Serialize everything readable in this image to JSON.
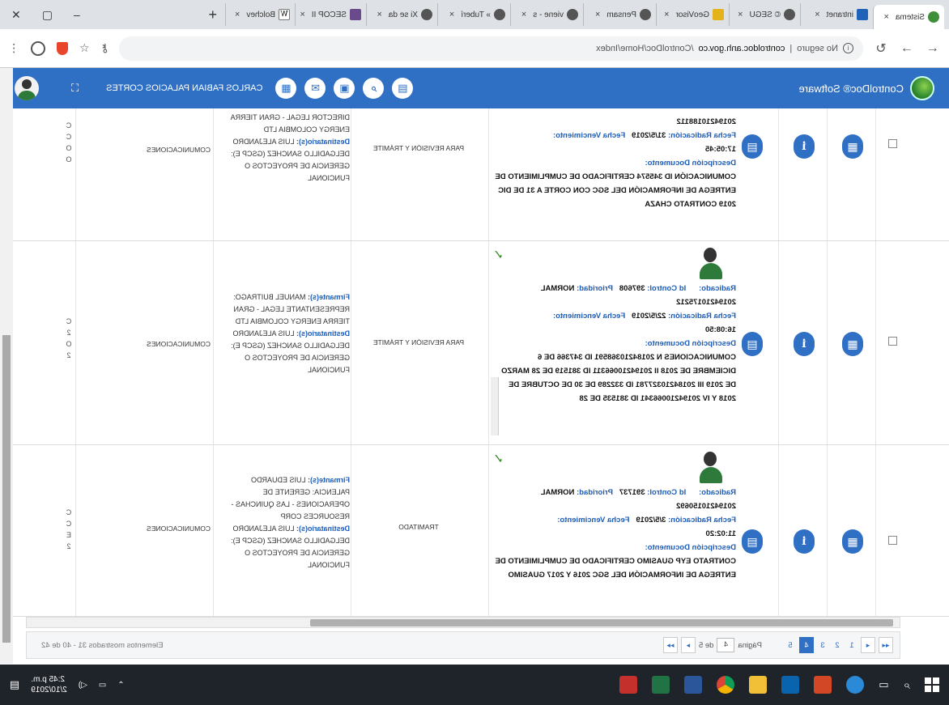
{
  "browser": {
    "tabs": [
      {
        "label": "Sistema",
        "icon": "app-logo-icon",
        "active": true
      },
      {
        "label": "intranet",
        "icon": "intranet-icon"
      },
      {
        "label": "© SEGU",
        "icon": "globe-icon"
      },
      {
        "label": "GeoVisor",
        "icon": "geovisor-icon"
      },
      {
        "label": "Pensam",
        "icon": "globe-icon"
      },
      {
        "label": "viene - s",
        "icon": "globe-icon"
      },
      {
        "label": "» Tuberí",
        "icon": "globe-icon"
      },
      {
        "label": "Xi se da",
        "icon": "globe-icon"
      },
      {
        "label": "SECOP II",
        "icon": "secop-icon"
      },
      {
        "label": "Bolchev",
        "icon": "wikipedia-icon"
      }
    ],
    "tab_close": "×",
    "new_tab": "+",
    "window_controls": {
      "minimize": "–",
      "maximize": "▢",
      "close": "✕"
    },
    "security": "No seguro",
    "url_host": "controldoc.anh.gov.co",
    "url_path": "/ControlDoc/Home/Index"
  },
  "app": {
    "brand": "ControlDoc® Software",
    "user_name": "CARLOS FABIAN PALACIOS CORTES",
    "header_icons": [
      "document-icon",
      "search-icon",
      "inbox-icon",
      "mail-icon",
      "report-icon"
    ],
    "fullscreen": "⛶"
  },
  "rows": [
    {
      "radicado_no": "20194210188112",
      "fecha_radicacion_label": "Fecha Radicación:",
      "fecha_radicacion": "31/5/2019",
      "fecha_venc_label": "Fecha Vencimiento:",
      "hora": "17:05:45",
      "desc_label": "Descripción Documento:",
      "descripcion": "COMUNICACIÓN ID 345574 CERTIFICADO DE CUMPLIMIENTO DE ENTREGA DE INFORMACIÓN DEL SGC CON CORTE A 31 DE DIC 2019 CONTRATO CHAZA",
      "estado": "PARA REVISIÓN Y TRÁMITE",
      "firmante_label": "",
      "firmante": "DIRECTOR LEGAL - GRAN TIERRA ENERGY COLOMBIA LTD",
      "destinatario_label": "Destinatario(s):",
      "destinatario": "LUIS ALEJANDRO DELGADILLO SANCHEZ (GSCP E): GERENCIA DE PROYECTOS O FUNCIONAL",
      "dependencia": "COMUNICACIONES",
      "code": [
        "C",
        "C",
        "O",
        "O"
      ]
    },
    {
      "radicado_label": "Radicado:",
      "id_control_label": "Id Control:",
      "id_control": "397608",
      "prioridad_label": "Prioridad:",
      "prioridad": "NORMAL",
      "radicado_no": "20194210175212",
      "fecha_radicacion_label": "Fecha Radicación:",
      "fecha_radicacion": "22/5/2019",
      "fecha_venc_label": "Fecha Vencimiento:",
      "hora": "16:08:50",
      "desc_label": "Descripción Documento:",
      "descripcion": "COMUNICACIONES N 20184210368591 ID 347366 DE 6 DICIEMBRE DE 2018 II 20194210066311 ID 381519 DE 28 MARZO DE 2019 III 20184210327781 ID 332289 DE 30 DE OCTUBRE DE 2018 Y IV 20194210066341 ID 381535 DE 28",
      "estado": "PARA REVISIÓN Y TRÁMITE",
      "firmante_label": "Firmante(s):",
      "firmante": "MANUEL BUITRAGO: REPRESENTANTE LEGAL - GRAN TIERRA ENERGY COLOMBIA LTD",
      "destinatario_label": "Destinatario(s):",
      "destinatario": "LUIS ALEJANDRO DELGADILLO SANCHEZ (GSCP E): GERENCIA DE PROYECTOS O FUNCIONAL",
      "dependencia": "COMUNICACIONES",
      "code": [
        "C",
        "2",
        "O",
        "2"
      ]
    },
    {
      "radicado_label": "Radicado:",
      "id_control_label": "Id Control:",
      "id_control": "391737",
      "prioridad_label": "Prioridad:",
      "prioridad": "NORMAL",
      "radicado_no": "20194210150692",
      "fecha_radicacion_label": "Fecha Radicación:",
      "fecha_radicacion": "3/5/2019",
      "fecha_venc_label": "Fecha Vencimiento:",
      "hora": "11:02:20",
      "desc_label": "Descripción Documento:",
      "descripcion": "CONTRATO EYP GUASIMO CERTIFICADO DE CUMPLIMIENTO DE ENTREGA DE INFORMACIÓN DEL SGC 2016 Y 2017 GUASIMO",
      "estado": "TRAMITADO",
      "firmante_label": "Firmante(s):",
      "firmante": "LUIS EDUARDO PALENCIA: GERENTE DE OPERACIONES - LAS QUINCHAS - RESOURCES CORP",
      "destinatario_label": "Destinatario(s):",
      "destinatario": "LUIS ALEJANDRO DELGADILLO SANCHEZ (GSCP E): GERENCIA DE PROYECTOS O FUNCIONAL",
      "dependencia": "COMUNICACIONES",
      "code": [
        "C",
        "C",
        "E",
        "2"
      ]
    }
  ],
  "row_buttons": {
    "view": "▤",
    "info": "i",
    "doc": "▦"
  },
  "pager": {
    "first": "◂◂",
    "prev": "◂",
    "pages": [
      "1",
      "2",
      "3",
      "4",
      "5"
    ],
    "current": "4",
    "next": "▸",
    "last": "▸▸",
    "page_label": "Página",
    "page_value": "4",
    "of_label": "de 5",
    "info": "Elementos mostrados 31 - 40 de 42"
  },
  "taskbar": {
    "time": "2:45 p.m.",
    "date": "2/10/2019",
    "apps": [
      "search-icon",
      "task-view-icon",
      "ie-icon",
      "powerpoint-icon",
      "outlook-icon",
      "explorer-icon",
      "chrome-icon",
      "word-icon",
      "excel-icon",
      "acrobat-icon"
    ]
  }
}
